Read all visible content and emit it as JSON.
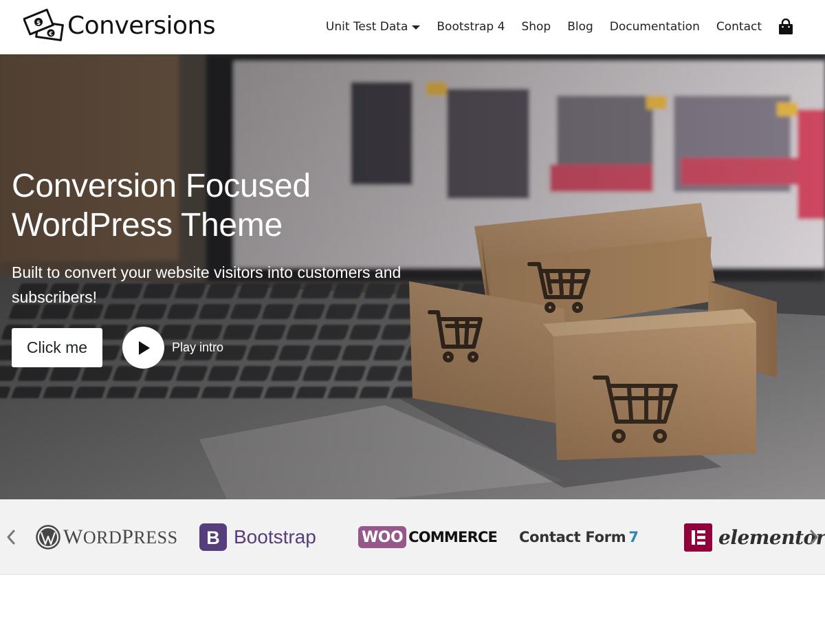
{
  "brand": {
    "name": "Conversions"
  },
  "nav": {
    "items": [
      {
        "label": "Unit Test Data",
        "has_dropdown": true
      },
      {
        "label": "Bootstrap 4",
        "has_dropdown": false
      },
      {
        "label": "Shop",
        "has_dropdown": false
      },
      {
        "label": "Blog",
        "has_dropdown": false
      },
      {
        "label": "Documentation",
        "has_dropdown": false
      },
      {
        "label": "Contact",
        "has_dropdown": false
      }
    ],
    "cart_icon": "shopping-bag-icon"
  },
  "hero": {
    "title_line1": "Conversion Focused",
    "title_line2": "WordPress Theme",
    "subtitle": "Built to convert your website visitors into customers and subscribers!",
    "primary_button": "Click me",
    "play_label": "Play intro",
    "background": "photo-laptop-with-cardboard-shopping-cart-boxes"
  },
  "logos": {
    "prev_icon": "chevron-left-icon",
    "next_icon": "chevron-right-icon",
    "items": [
      {
        "name": "WordPress",
        "text_w": "W",
        "text_rest": "ORD",
        "text_p": "P",
        "text_rest2": "RESS"
      },
      {
        "name": "Bootstrap",
        "badge": "B",
        "text": "Bootstrap"
      },
      {
        "name": "WooCommerce",
        "badge": "WOO",
        "text": "COMMERCE"
      },
      {
        "name": "Contact Form 7",
        "text": "Contact Form",
        "num": "7"
      },
      {
        "name": "Elementor",
        "text": "elementor"
      }
    ]
  },
  "colors": {
    "wordpress": "#464646",
    "bootstrap": "#563d7c",
    "woocommerce": "#96588a",
    "cf7": "#2f86b6",
    "elementor": "#92003b"
  }
}
